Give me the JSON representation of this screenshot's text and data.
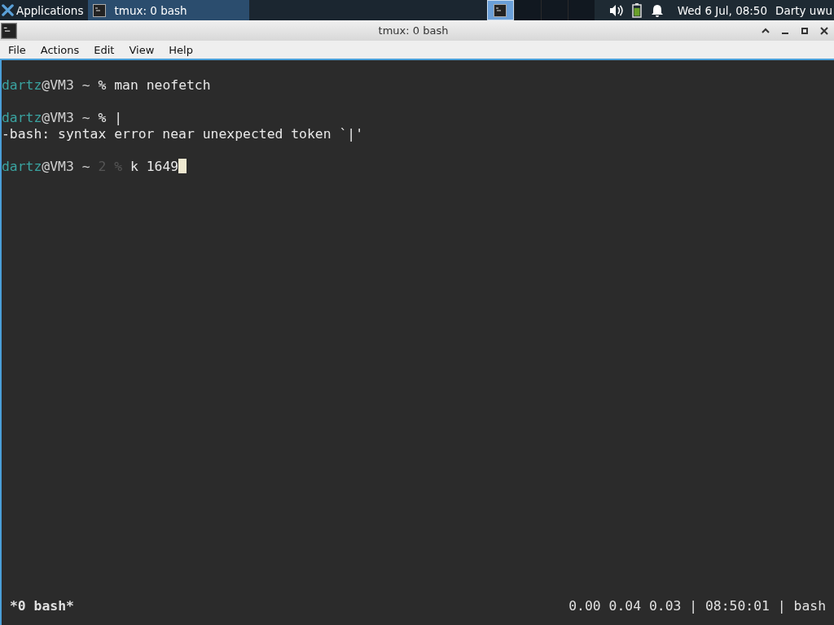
{
  "taskbar": {
    "apps_menu": "Applications",
    "tasks": [
      {
        "label": "tmux: 0 bash",
        "selected": true
      }
    ],
    "workspaces": [
      {
        "selected": true
      },
      {
        "selected": false
      },
      {
        "selected": false
      },
      {
        "selected": false
      }
    ],
    "battery": {
      "level": 0.8
    },
    "clock": "Wed  6 Jul, 08:50",
    "user": "Darty uwu"
  },
  "window": {
    "title": "tmux: 0 bash"
  },
  "menu": [
    "File",
    "Actions",
    "Edit",
    "View",
    "Help"
  ],
  "terminal": {
    "lines": [
      {
        "kind": "blank"
      },
      {
        "kind": "prompt",
        "user": "dartz",
        "host": "@VM3 ~",
        "sign": "%",
        "command": "man neofetch"
      },
      {
        "kind": "blank"
      },
      {
        "kind": "prompt",
        "user": "dartz",
        "host": "@VM3 ~",
        "sign": "%",
        "command": "|"
      },
      {
        "kind": "output",
        "text": "-bash: syntax error near unexpected token `|'"
      },
      {
        "kind": "blank"
      },
      {
        "kind": "prompt",
        "user": "dartz",
        "host": "@VM3 ~",
        "code": "2",
        "sign": "%",
        "command": "k 1649",
        "cursor": true
      }
    ]
  },
  "status_bar": {
    "window_label": "*0 bash*",
    "right": "0.00 0.04 0.03 | 08:50:01 | bash"
  }
}
